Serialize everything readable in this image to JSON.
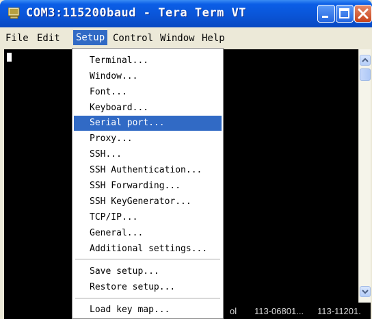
{
  "window": {
    "title": "COM3:115200baud - Tera Term VT",
    "controls": {
      "minimize": "minimize",
      "maximize": "maximize",
      "close": "close"
    }
  },
  "menubar": {
    "items": [
      {
        "label": "File"
      },
      {
        "label": "Edit"
      },
      {
        "label": "Setup",
        "active": true
      },
      {
        "label": "Control"
      },
      {
        "label": "Window"
      },
      {
        "label": "Help"
      }
    ]
  },
  "setup_menu": {
    "items": [
      {
        "label": "Terminal..."
      },
      {
        "label": "Window..."
      },
      {
        "label": "Font..."
      },
      {
        "label": "Keyboard..."
      },
      {
        "label": "Serial port...",
        "selected": true
      },
      {
        "label": "Proxy..."
      },
      {
        "label": "SSH..."
      },
      {
        "label": "SSH Authentication..."
      },
      {
        "label": "SSH Forwarding..."
      },
      {
        "label": "SSH KeyGenerator..."
      },
      {
        "label": "TCP/IP..."
      },
      {
        "label": "General..."
      },
      {
        "label": "Additional settings..."
      },
      {
        "label": "Save setup..."
      },
      {
        "label": "Restore setup..."
      },
      {
        "label": "Load key map..."
      }
    ]
  },
  "statusbar": {
    "items": [
      "ol",
      "113-06801...",
      "113-11201."
    ]
  },
  "colors": {
    "titlebar": "#0a55d8",
    "terminal_bg": "#000000",
    "menu_highlight": "#316ac5",
    "chrome": "#ece9d8"
  }
}
